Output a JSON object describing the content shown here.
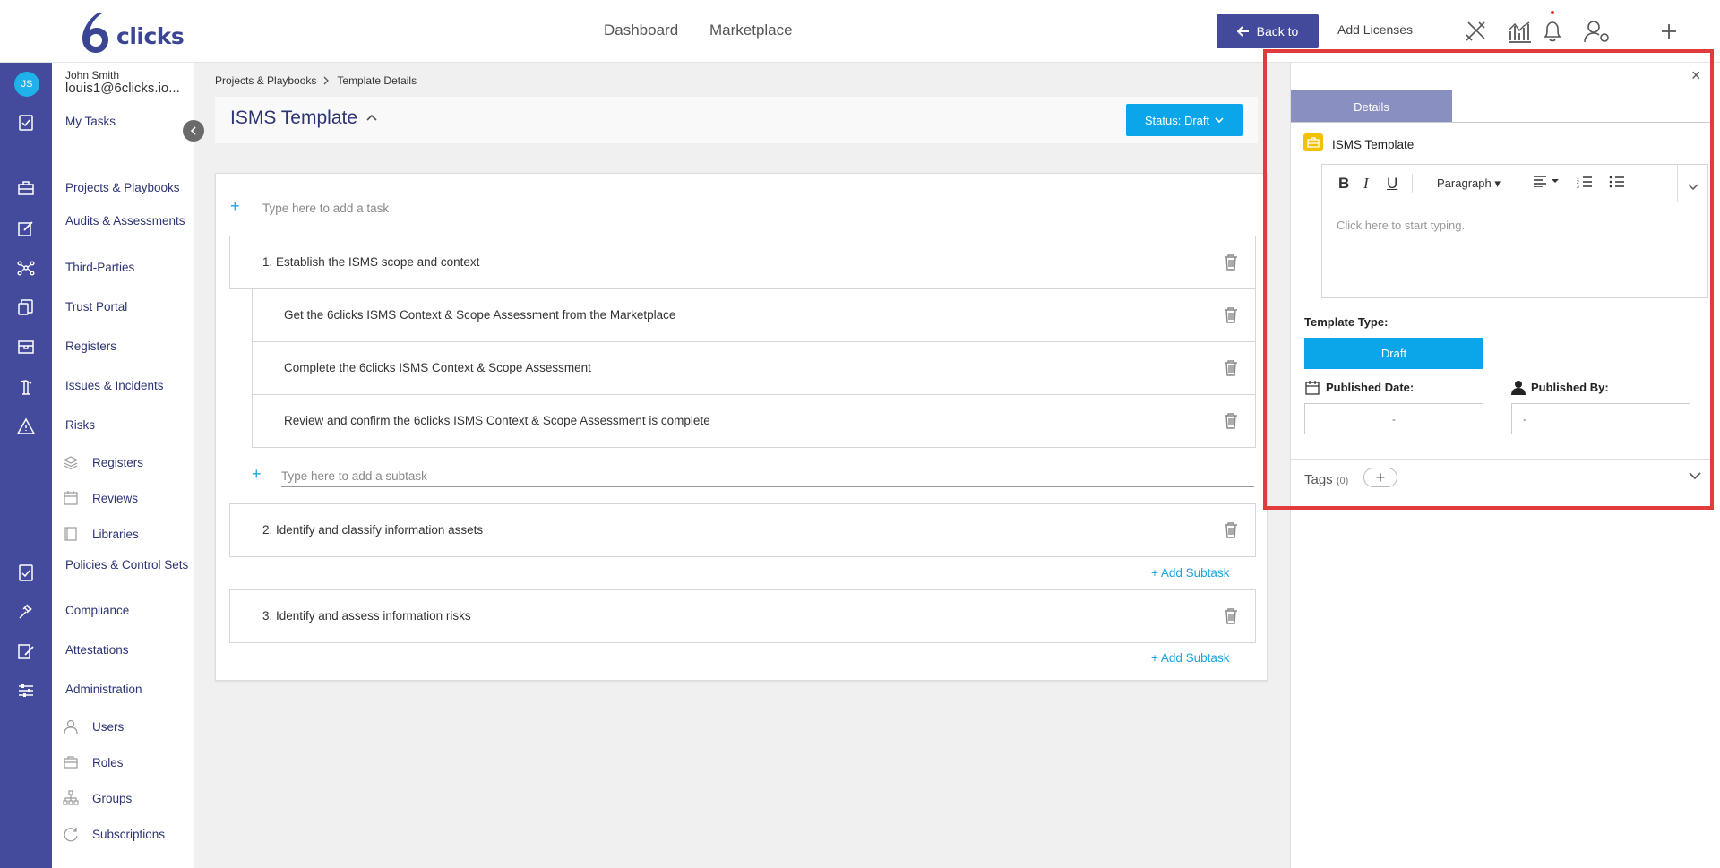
{
  "app": {
    "logo_text": "clicks"
  },
  "topbar": {
    "nav": [
      "Dashboard",
      "Marketplace"
    ],
    "back_label": "Back to",
    "add_licenses": "Add Licenses"
  },
  "user": {
    "initials": "JS",
    "name": "John Smith",
    "email": "louis1@6clicks.io..."
  },
  "sidebar": {
    "my_tasks": "My Tasks",
    "items": [
      "Projects & Playbooks",
      "Audits & Assessments",
      "Third-Parties",
      "Trust Portal",
      "Registers",
      "Issues & Incidents",
      "Risks"
    ],
    "risk_subitems": [
      "Registers",
      "Reviews",
      "Libraries"
    ],
    "items2": [
      "Policies & Control Sets",
      "Compliance",
      "Attestations",
      "Administration"
    ],
    "admin_subitems": [
      "Users",
      "Roles",
      "Groups",
      "Subscriptions"
    ]
  },
  "breadcrumb": [
    "Projects & Playbooks",
    "Template Details"
  ],
  "page": {
    "title": "ISMS Template",
    "status_label": "Status: Draft"
  },
  "tasks": {
    "add_task_placeholder": "Type here to add a task",
    "add_subtask_placeholder": "Type here to add a subtask",
    "add_subtask_link": "Add Subtask",
    "items": [
      {
        "label": "1. Establish the ISMS scope and context",
        "subtasks": [
          "Get the 6clicks ISMS Context & Scope Assessment from the Marketplace",
          "Complete the 6clicks ISMS Context & Scope Assessment",
          "Review and confirm the 6clicks ISMS Context & Scope Assessment is complete"
        ]
      },
      {
        "label": "2. Identify and classify information assets",
        "subtasks": []
      },
      {
        "label": "3. Identify and assess information risks",
        "subtasks": []
      }
    ]
  },
  "panel": {
    "tab": "Details",
    "project_title": "ISMS Template",
    "editor": {
      "paragraph": "Paragraph",
      "placeholder": "Click here to start typing."
    },
    "template_type_label": "Template Type:",
    "template_type_value": "Draft",
    "published_date_label": "Published Date:",
    "published_date_value": "-",
    "published_by_label": "Published By:",
    "published_by_value": "-",
    "tags_label": "Tags",
    "tags_count": "(0)"
  },
  "colors": {
    "brand": "#444b9d",
    "accent": "#0ba5ea",
    "highlight": "#e33b3b"
  }
}
